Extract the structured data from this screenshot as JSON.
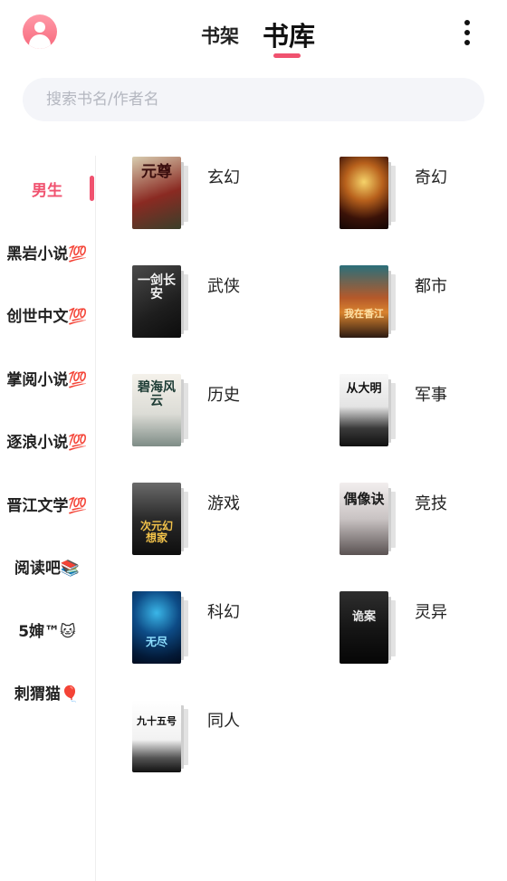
{
  "header": {
    "tabs": [
      {
        "label": "书架"
      },
      {
        "label": "书库"
      }
    ]
  },
  "search": {
    "placeholder": "搜索书名/作者名"
  },
  "sidebar": {
    "items": [
      {
        "label": "男生"
      },
      {
        "label": "黑岩小说💯"
      },
      {
        "label": "创世中文💯"
      },
      {
        "label": "掌阅小说💯"
      },
      {
        "label": "逐浪小说💯"
      },
      {
        "label": "晋江文学💯"
      },
      {
        "label": "阅读吧📚"
      },
      {
        "label": "5婶™🐱"
      },
      {
        "label": "刺猬猫🎈"
      }
    ]
  },
  "categories": [
    {
      "name": "玄幻",
      "cover_title": "元尊"
    },
    {
      "name": "奇幻",
      "cover_title": ""
    },
    {
      "name": "武侠",
      "cover_title": "一剑长安"
    },
    {
      "name": "都市",
      "cover_title": "我在香江"
    },
    {
      "name": "历史",
      "cover_title": "碧海风云"
    },
    {
      "name": "军事",
      "cover_title": "从大明"
    },
    {
      "name": "游戏",
      "cover_title": "次元幻想家"
    },
    {
      "name": "竞技",
      "cover_title": "偶像诀"
    },
    {
      "name": "科幻",
      "cover_title": "无尽"
    },
    {
      "name": "灵异",
      "cover_title": "诡案"
    },
    {
      "name": "同人",
      "cover_title": "九十五号"
    }
  ],
  "colors": {
    "accent": "#f0526f",
    "search_bg": "#f4f5f9"
  }
}
